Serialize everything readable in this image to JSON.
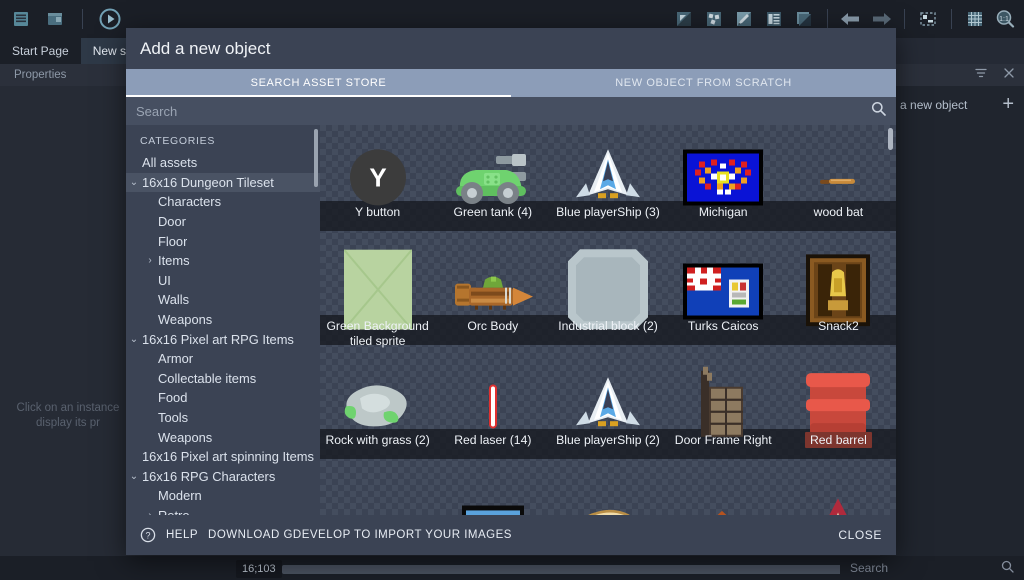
{
  "ide": {
    "toolbar_left": [
      {
        "name": "project-manager-icon",
        "label": "Project Manager"
      },
      {
        "name": "scene-editor-icon",
        "label": "Scene Editor"
      },
      {
        "name": "preview-play-icon",
        "label": "Preview"
      }
    ],
    "toolbar_right": [
      {
        "name": "add-object-icon",
        "label": "Add object"
      },
      {
        "name": "add-object-group-icon",
        "label": "Add object group"
      },
      {
        "name": "edit-icon",
        "label": "Edit"
      },
      {
        "name": "layers-icon",
        "label": "Layers"
      },
      {
        "name": "layer-up-icon",
        "label": "Layer up"
      },
      {
        "name": "undo-icon",
        "label": "Undo"
      },
      {
        "name": "redo-icon",
        "label": "Redo"
      },
      {
        "name": "zone-icon",
        "label": "Zone"
      },
      {
        "name": "grid-icon",
        "label": "Grid"
      },
      {
        "name": "zoom-icon",
        "label": "Zoom"
      }
    ],
    "tabs": [
      {
        "label": "Start Page",
        "active": false
      },
      {
        "label": "New sce",
        "active": true
      }
    ],
    "properties_label": "Properties",
    "canvas_hint": "Click on an instance  display its pr",
    "right_panel": {
      "add_object_label": "d a new object",
      "add_icon": "+",
      "filter_icon": "filter-icon",
      "close_icon": "close-icon"
    },
    "status": {
      "coordinates": "16;103",
      "search_placeholder": "Search",
      "search_icon": "search-icon"
    }
  },
  "dialog": {
    "title": "Add a new object",
    "tabs": [
      {
        "label": "SEARCH ASSET STORE",
        "active": true
      },
      {
        "label": "NEW OBJECT FROM SCRATCH",
        "active": false
      }
    ],
    "search": {
      "value": "",
      "placeholder": "Search",
      "icon": "search-icon"
    },
    "categories_title": "CATEGORIES",
    "categories": [
      {
        "label": "All assets",
        "level": 0,
        "arrow": "",
        "selected": false
      },
      {
        "label": "16x16 Dungeon Tileset",
        "level": 0,
        "arrow": "expanded",
        "selected": true
      },
      {
        "label": "Characters",
        "level": 1,
        "arrow": "",
        "selected": false
      },
      {
        "label": "Door",
        "level": 1,
        "arrow": "",
        "selected": false
      },
      {
        "label": "Floor",
        "level": 1,
        "arrow": "",
        "selected": false
      },
      {
        "label": "Items",
        "level": 1,
        "arrow": "collapsed",
        "selected": false
      },
      {
        "label": "UI",
        "level": 1,
        "arrow": "",
        "selected": false
      },
      {
        "label": "Walls",
        "level": 1,
        "arrow": "",
        "selected": false
      },
      {
        "label": "Weapons",
        "level": 1,
        "arrow": "",
        "selected": false
      },
      {
        "label": "16x16 Pixel art RPG Items",
        "level": 0,
        "arrow": "expanded",
        "selected": false
      },
      {
        "label": "Armor",
        "level": 1,
        "arrow": "",
        "selected": false
      },
      {
        "label": "Collectable items",
        "level": 1,
        "arrow": "",
        "selected": false
      },
      {
        "label": "Food",
        "level": 1,
        "arrow": "",
        "selected": false
      },
      {
        "label": "Tools",
        "level": 1,
        "arrow": "",
        "selected": false
      },
      {
        "label": "Weapons",
        "level": 1,
        "arrow": "",
        "selected": false
      },
      {
        "label": "16x16 Pixel art spinning Items",
        "level": 0,
        "arrow": "",
        "selected": false
      },
      {
        "label": "16x16 RPG Characters",
        "level": 0,
        "arrow": "expanded",
        "selected": false
      },
      {
        "label": "Modern",
        "level": 1,
        "arrow": "",
        "selected": false
      },
      {
        "label": "Retro",
        "level": 1,
        "arrow": "collapsed",
        "selected": false
      }
    ],
    "assets": [
      [
        {
          "label": "Y button",
          "art": "y-button",
          "selected": false
        },
        {
          "label": "Green tank (4)",
          "art": "green-tank",
          "selected": false
        },
        {
          "label": "Blue playerShip (3)",
          "art": "blue-ship",
          "selected": false
        },
        {
          "label": "Michigan",
          "art": "michigan-flag",
          "selected": false
        },
        {
          "label": "wood bat",
          "art": "wood-bat",
          "selected": false
        }
      ],
      [
        {
          "label": "Green Background tiled sprite",
          "art": "green-background",
          "selected": false
        },
        {
          "label": "Orc Body",
          "art": "orc-body",
          "selected": false
        },
        {
          "label": "Industrial block (2)",
          "art": "industrial-block",
          "selected": false
        },
        {
          "label": "Turks Caicos",
          "art": "turks-caicos-flag",
          "selected": false
        },
        {
          "label": "Snack2",
          "art": "snack2",
          "selected": false
        }
      ],
      [
        {
          "label": "Rock with grass (2)",
          "art": "rock-with-grass",
          "selected": false
        },
        {
          "label": "Red laser (14)",
          "art": "red-laser",
          "selected": false
        },
        {
          "label": "Blue playerShip (2)",
          "art": "blue-ship",
          "selected": false
        },
        {
          "label": "Door Frame Right",
          "art": "door-frame-right",
          "selected": false
        },
        {
          "label": "Red barrel",
          "art": "red-barrel",
          "selected": true
        }
      ],
      [
        {
          "label": "",
          "art": "red-berries",
          "selected": false
        },
        {
          "label": "",
          "art": "blue-flag-bar",
          "selected": false
        },
        {
          "label": "",
          "art": "bread",
          "selected": false
        },
        {
          "label": "",
          "art": "dirt-pile",
          "selected": false
        },
        {
          "label": "",
          "art": "red-tent",
          "selected": false
        }
      ]
    ],
    "footer": {
      "help_icon": "help-circle-icon",
      "help_label": "HELP",
      "download_label": "DOWNLOAD GDEVELOP TO IMPORT YOUR IMAGES",
      "close_label": "CLOSE"
    }
  }
}
